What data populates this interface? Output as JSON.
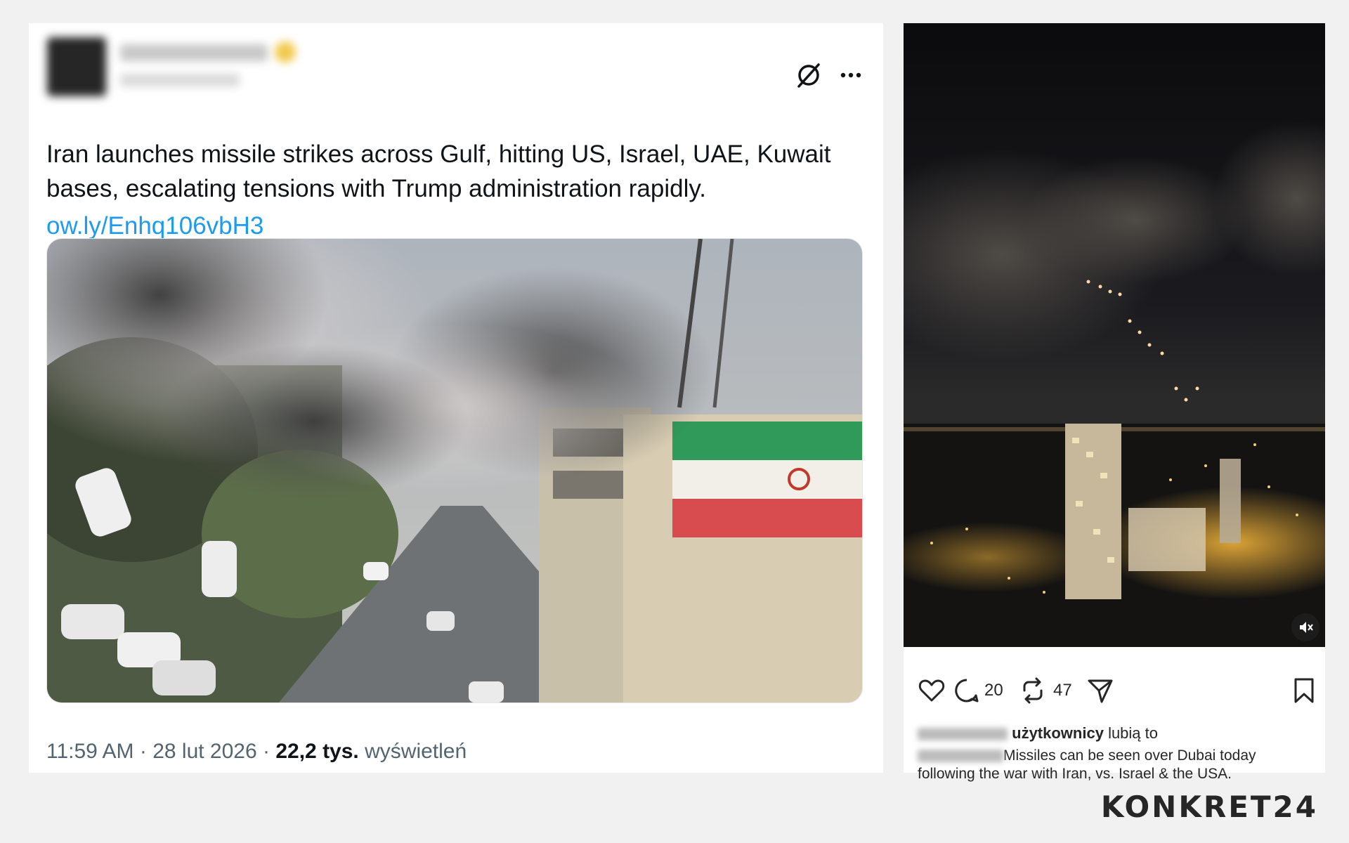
{
  "tweet": {
    "text": "Iran launches missile strikes across Gulf, hitting US, Israel, UAE, Kuwait bases, escalating tensions with Trump administration rapidly.",
    "link": "ow.ly/Enhq106vbH3",
    "time": "11:59 AM",
    "date": "28 lut 2026",
    "views_count": "22,2 tys.",
    "views_label": "wyświetleń",
    "icons": [
      "grok-icon",
      "more-icon"
    ]
  },
  "instagram": {
    "comments": "20",
    "reposts": "47",
    "likes_label_bold": "użytkownicy",
    "likes_label_rest": "lubią to",
    "caption": "Missiles can be seen over Dubai today following the war with Iran, vs. Israel & the USA.",
    "icons": [
      "heart-icon",
      "comment-icon",
      "repost-icon",
      "share-icon",
      "bookmark-icon",
      "muted-icon"
    ]
  },
  "logo": {
    "text": "KONKRET24"
  }
}
